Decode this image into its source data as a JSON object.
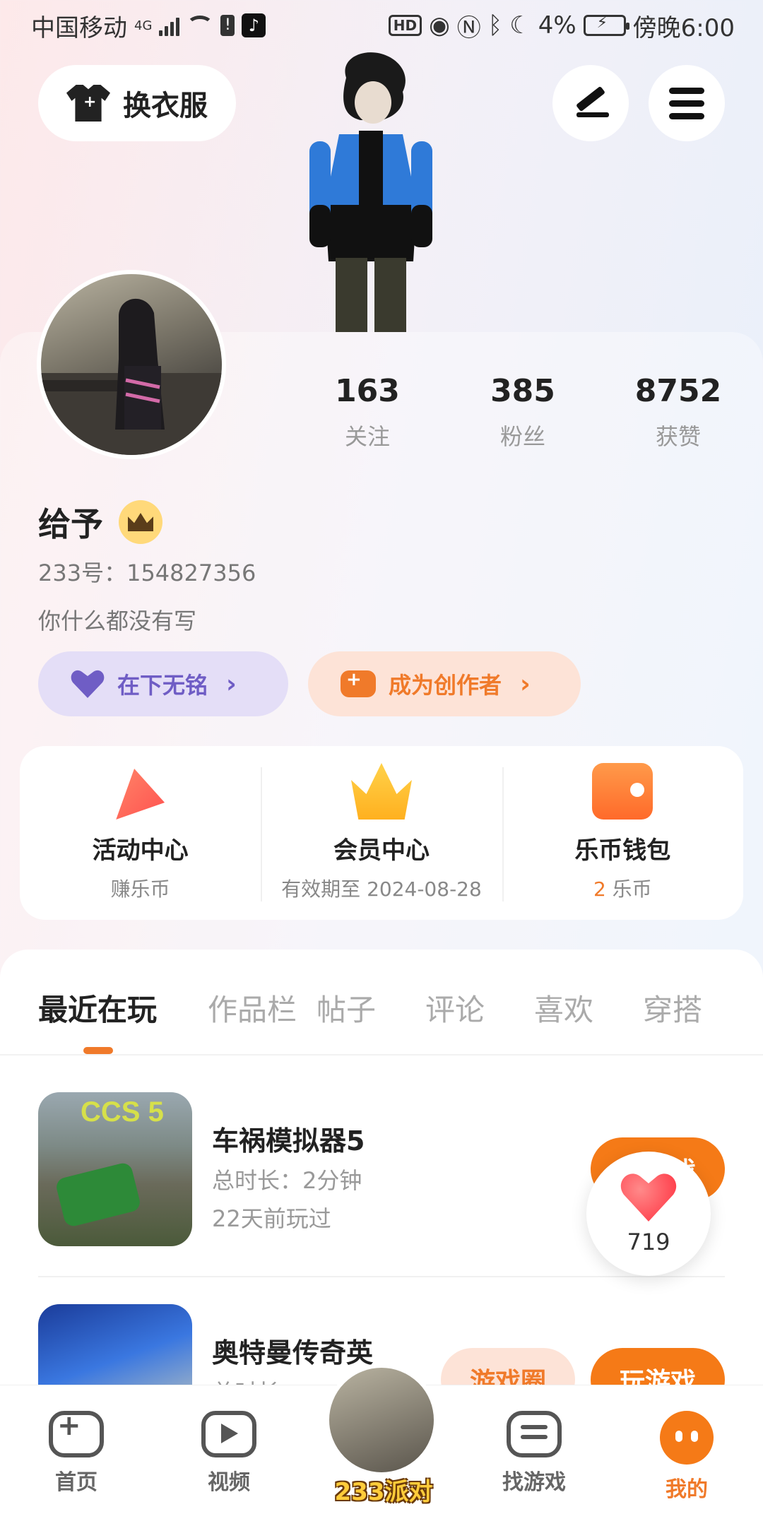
{
  "status_bar": {
    "carrier": "中国移动",
    "network": "4G",
    "battery": "4%",
    "time": "傍晚6:00"
  },
  "header": {
    "outfit_label": "换衣服",
    "edit_icon": "edit-icon",
    "menu_icon": "menu-icon"
  },
  "profile": {
    "name": "给予",
    "uid": "233号：154827356",
    "bio": "你什么都没有写",
    "stats": [
      {
        "value": "163",
        "label": "关注"
      },
      {
        "value": "385",
        "label": "粉丝"
      },
      {
        "value": "8752",
        "label": "获赞"
      }
    ],
    "pills": {
      "guild": "在下无铭",
      "creator": "成为创作者"
    }
  },
  "shortcuts": [
    {
      "title": "活动中心",
      "sub": "赚乐币",
      "icon": "party-icon"
    },
    {
      "title": "会员中心",
      "sub": "有效期至 2024-08-28",
      "icon": "crown-icon"
    },
    {
      "title": "乐币钱包",
      "sub_num": "2",
      "sub_unit": "乐币",
      "icon": "wallet-icon"
    }
  ],
  "tabs": [
    "最近在玩",
    "作品栏",
    "帖子",
    "评论",
    "喜欢",
    "穿搭"
  ],
  "games": [
    {
      "title": "车祸模拟器5",
      "duration": "总时长：2分钟",
      "last": "22天前玩过",
      "button": "玩游戏",
      "thumb_text": "CCS 5"
    },
    {
      "title": "奥特曼传奇英",
      "duration": "总时长：",
      "circle": "游戏圈",
      "button": "玩游戏"
    }
  ],
  "like_float": {
    "count": "719"
  },
  "nav": [
    {
      "label": "首页",
      "icon": "gamepad-icon"
    },
    {
      "label": "视频",
      "icon": "video-icon"
    },
    {
      "label": "233派对",
      "icon": "avatar"
    },
    {
      "label": "找游戏",
      "icon": "list-icon"
    },
    {
      "label": "我的",
      "icon": "me-icon"
    }
  ],
  "colors": {
    "accent": "#f57a17",
    "purple": "#6f5dc5"
  }
}
